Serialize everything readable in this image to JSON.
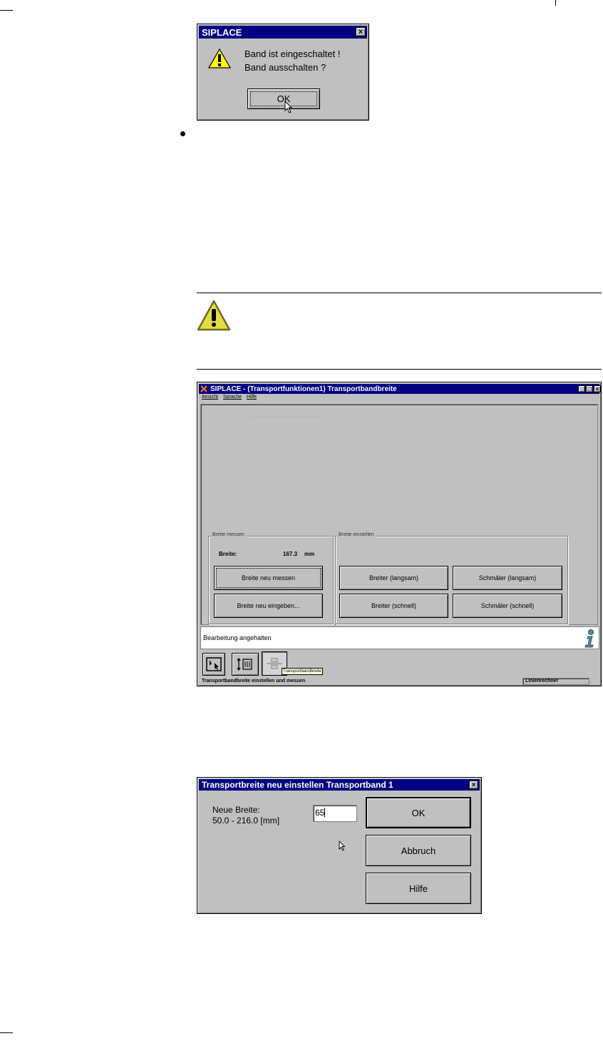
{
  "dialog1": {
    "title": "SIPLACE",
    "message_line1": "Band ist eingeschaltet !",
    "message_line2": "Band ausschalten ?",
    "ok_label": "OK",
    "close_glyph": "×"
  },
  "main_window": {
    "title": "SIPLACE - (Transportfunktionen1) Transportbandbreite",
    "menu": [
      "Ansicht",
      "Sprache",
      "Hilfe"
    ],
    "group_measure": {
      "label": "Breite messen",
      "width_label": "Breite:",
      "width_value": "167.3",
      "width_unit": "mm",
      "btn_measure": "Breite neu messen",
      "btn_enter": "Breite neu eingeben..."
    },
    "group_adjust": {
      "label": "Breite einstellen",
      "btn_wider_slow": "Breiter (langsam)",
      "btn_narrower_slow": "Schmäler (langsam)",
      "btn_wider_fast": "Breiter (schnell)",
      "btn_narrower_fast": "Schmäler (schnell)"
    },
    "status_message": "Bearbeitung angehalten",
    "tooltip": "Transportbandbreite",
    "statusbar_left": "Transportbandbreite einstellen und messen",
    "statusbar_right": "Linienrechner"
  },
  "dialog2": {
    "title": "Transportbreite neu einstellen Transportband 1",
    "label_line1": "Neue Breite:",
    "label_line2": "50.0 - 216.0 [mm]",
    "input_value": "65",
    "ok_label": "OK",
    "cancel_label": "Abbruch",
    "help_label": "Hilfe",
    "close_glyph": "×"
  }
}
